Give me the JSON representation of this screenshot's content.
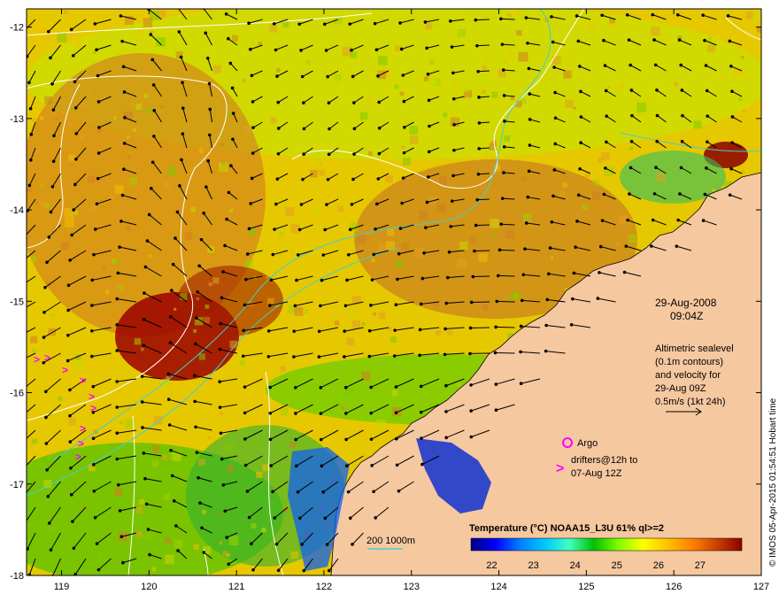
{
  "map": {
    "lon_range": [
      118.6,
      127.0
    ],
    "lat_range": [
      -18.0,
      -11.8
    ],
    "lon_ticks": [
      "119",
      "120",
      "121",
      "122",
      "123",
      "124",
      "125",
      "126",
      "127"
    ],
    "lat_ticks": [
      "-12",
      "-13",
      "-14",
      "-15",
      "-16",
      "-17",
      "-18"
    ]
  },
  "annotations": {
    "date_line1": "29-Aug-2008",
    "date_line2": "09:04Z",
    "altimetry_l1": "Altimetric sealevel",
    "altimetry_l2": "(0.1m contours)",
    "altimetry_l3": "and velocity for",
    "altimetry_l4": "29-Aug 09Z",
    "altimetry_l5": "0.5m/s (1kt 24h)",
    "argo_label": "Argo",
    "drifters_l1": "drifters@12h to",
    "drifters_l2": "07-Aug 12Z",
    "isobath_label": "200  1000m",
    "credit": "© IMOS 05-Apr-2015 01:54:51 Hobart time"
  },
  "colorbar": {
    "title": "Temperature (°C) NOAA15_L3U 61% ql>=2",
    "ticks": [
      "22",
      "23",
      "24",
      "25",
      "26",
      "27"
    ],
    "colors": [
      "#00007f",
      "#0000ff",
      "#0080ff",
      "#00c8ff",
      "#40ffbf",
      "#00c000",
      "#80ff00",
      "#ffff00",
      "#ffc000",
      "#ff8000",
      "#c84000",
      "#8b0000"
    ]
  },
  "colors": {
    "land": "#f6c8a0",
    "contour": "#ffffff",
    "isobath": "#40d0d0",
    "drifter": "#ff00ff"
  }
}
